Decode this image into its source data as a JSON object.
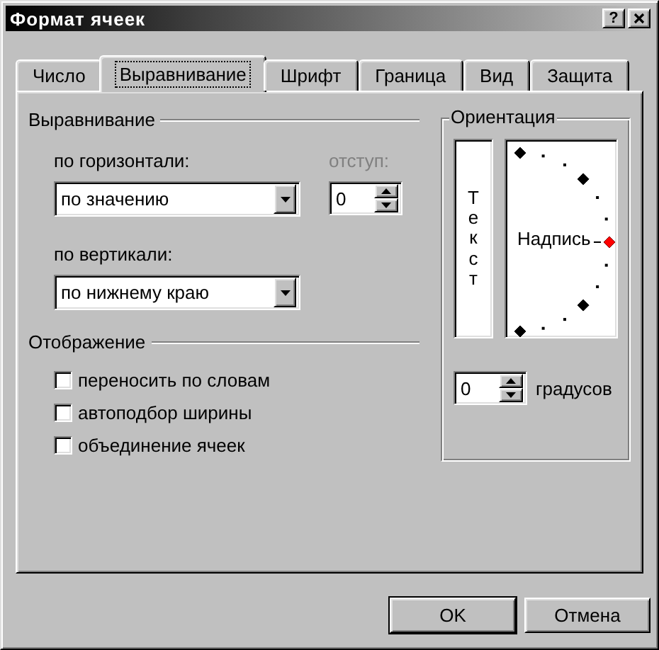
{
  "window": {
    "title": "Формат ячеек",
    "help_button": "?"
  },
  "tabs": [
    {
      "label": "Число",
      "selected": false
    },
    {
      "label": "Выравнивание",
      "selected": true
    },
    {
      "label": "Шрифт",
      "selected": false
    },
    {
      "label": "Граница",
      "selected": false
    },
    {
      "label": "Вид",
      "selected": false
    },
    {
      "label": "Защита",
      "selected": false
    }
  ],
  "alignment": {
    "title": "Выравнивание",
    "horizontal": {
      "label": "по горизонтали:",
      "value": "по значению"
    },
    "indent": {
      "label": "отступ:",
      "disabled": true,
      "value": "0"
    },
    "vertical": {
      "label": "по вертикали:",
      "value": "по нижнему краю"
    }
  },
  "display": {
    "title": "Отображение",
    "options": [
      {
        "label": "переносить по словам",
        "checked": false
      },
      {
        "label": "автоподбор ширины",
        "checked": false
      },
      {
        "label": "объединение ячеек",
        "checked": false
      }
    ]
  },
  "orientation": {
    "title": "Ориентация",
    "vertical_text": "Текст",
    "dial_text": "Надпись",
    "degrees": {
      "value": "0",
      "label": "градусов"
    }
  },
  "buttons": [
    {
      "label": "OK",
      "default": true
    },
    {
      "label": "Отмена",
      "default": false
    }
  ]
}
